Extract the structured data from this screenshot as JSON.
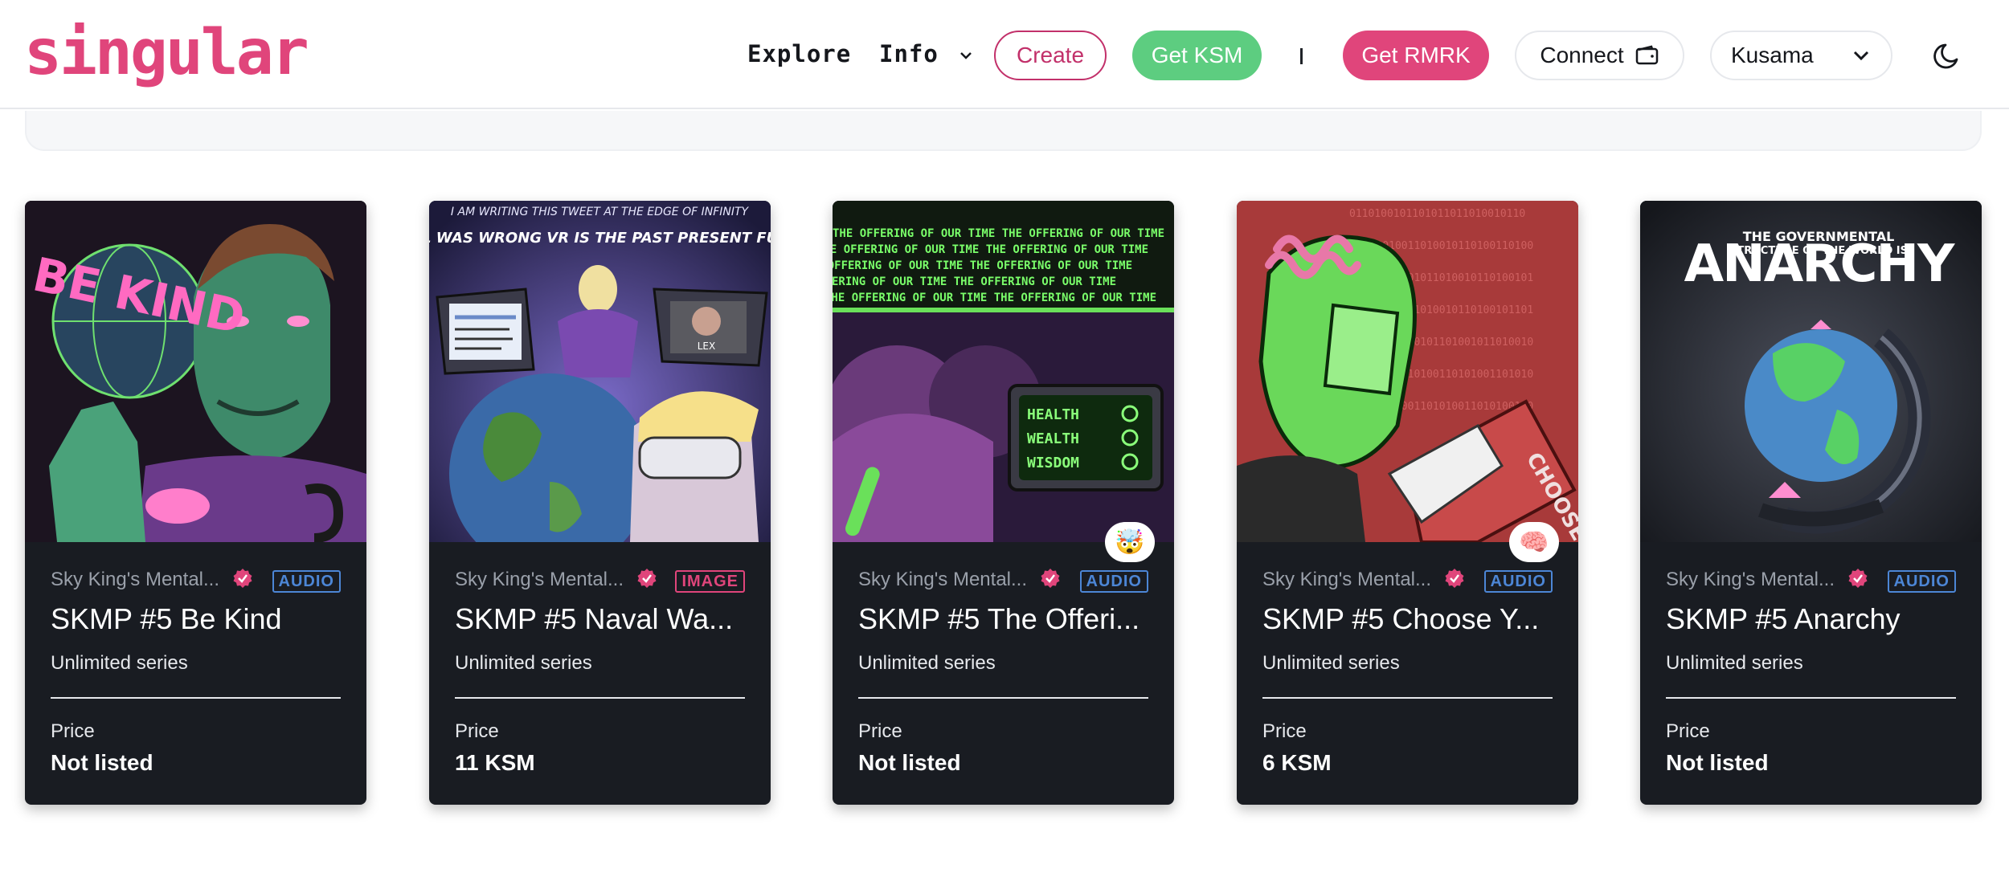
{
  "brand": {
    "logo_text": "singular",
    "accent": "#e0457b"
  },
  "nav": {
    "explore": "Explore",
    "info": "Info",
    "create": "Create",
    "get_ksm": "Get KSM",
    "separator": "|",
    "get_rmrk": "Get RMRK",
    "connect": "Connect",
    "network": "Kusama"
  },
  "cards": [
    {
      "collection": "Sky King's Mental...",
      "type": "AUDIO",
      "title": "SKMP #5 Be Kind",
      "series": "Unlimited series",
      "price_label": "Price",
      "price": "Not listed",
      "reaction": ""
    },
    {
      "collection": "Sky King's Mental...",
      "type": "IMAGE",
      "title": "SKMP #5 Naval Wa...",
      "series": "Unlimited series",
      "price_label": "Price",
      "price": "11 KSM",
      "reaction": ""
    },
    {
      "collection": "Sky King's Mental...",
      "type": "AUDIO",
      "title": "SKMP #5 The Offeri...",
      "series": "Unlimited series",
      "price_label": "Price",
      "price": "Not listed",
      "reaction": "🤯"
    },
    {
      "collection": "Sky King's Mental...",
      "type": "AUDIO",
      "title": "SKMP #5 Choose Y...",
      "series": "Unlimited series",
      "price_label": "Price",
      "price": "6 KSM",
      "reaction": "🧠"
    },
    {
      "collection": "Sky King's Mental...",
      "type": "AUDIO",
      "title": "SKMP #5 Anarchy",
      "series": "Unlimited series",
      "price_label": "Price",
      "price": "Not listed",
      "reaction": ""
    }
  ],
  "artwork_text": {
    "be_kind": "BE KIND",
    "naval_top": "I AM WRITING THIS TWEET AT THE EDGE OF INFINITY",
    "naval_main": "NAVAL WAS WRONG VR IS THE PAST PRESENT FUTURE",
    "naval_lex": "LEX",
    "offering_line": "THE OFFERING OF OUR TIME  THE OFFERING OF OUR TIME",
    "health": "HEALTH",
    "wealth": "WEALTH",
    "wisdom": "WISDOM",
    "choose": "CHOOSE",
    "anarchy": "ANARCHY",
    "anarchy_sub1": "THE GOVERNMENTAL",
    "anarchy_sub2": "STRUCTURE OF THE WORLD IS"
  }
}
